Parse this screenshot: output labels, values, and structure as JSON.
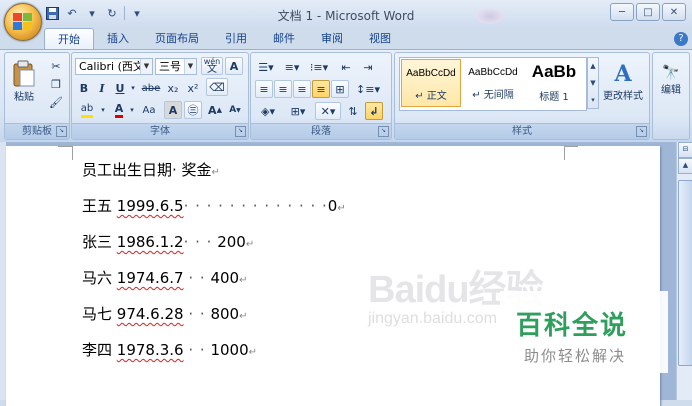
{
  "window": {
    "title": "文档 1 - Microsoft Word",
    "controls": [
      "─",
      "□",
      "✕"
    ]
  },
  "tabs": [
    "开始",
    "插入",
    "页面布局",
    "引用",
    "邮件",
    "审阅",
    "视图"
  ],
  "clipboard": {
    "paste_label": "粘贴",
    "group_label": "剪贴板"
  },
  "font": {
    "family": "Calibri (西文正文)",
    "size": "三号",
    "wen": "wén",
    "A": "A",
    "bold": "B",
    "italic": "I",
    "underline": "U",
    "strike": "abe",
    "sub": "x₂",
    "sup": "x²",
    "aa": "Aa",
    "grow": "A",
    "shrink": "A",
    "group_label": "字体"
  },
  "paragraph": {
    "group_label": "段落"
  },
  "styles": {
    "items": [
      {
        "preview": "AaBbCcDd",
        "name": "↵ 正文"
      },
      {
        "preview": "AaBbCcDd",
        "name": "↵ 无间隔"
      },
      {
        "preview": "AaBb",
        "name": "标题 1"
      }
    ],
    "change_label": "更改样式",
    "group_label": "样式"
  },
  "editing": {
    "label": "编辑"
  },
  "document": {
    "lines": [
      {
        "text": "员工出生日期· 奖金"
      },
      {
        "name": "王五 ",
        "date": "1999.6.5",
        "fill": "· · · · · · · · · · · · ·",
        "amount": "0"
      },
      {
        "name": "张三 ",
        "date": "1986.1.2",
        "fill": "· · ·",
        "amount": "200"
      },
      {
        "name": "马六 ",
        "date": "1974.6.7",
        "fill": "· ·",
        "amount": "400"
      },
      {
        "name": "马七 ",
        "date": "974.6.28",
        "fill": "· ·",
        "amount": "800"
      },
      {
        "name": "李四 ",
        "date": "1978.3.6",
        "fill": "· ·",
        "amount": "1000"
      }
    ],
    "para_mark": "↵"
  },
  "watermark": {
    "baidu": "Baidu经验",
    "jingyan": "jingyan.baidu.com",
    "badge_title": "百科全说",
    "badge_sub": "助你轻松解决"
  }
}
